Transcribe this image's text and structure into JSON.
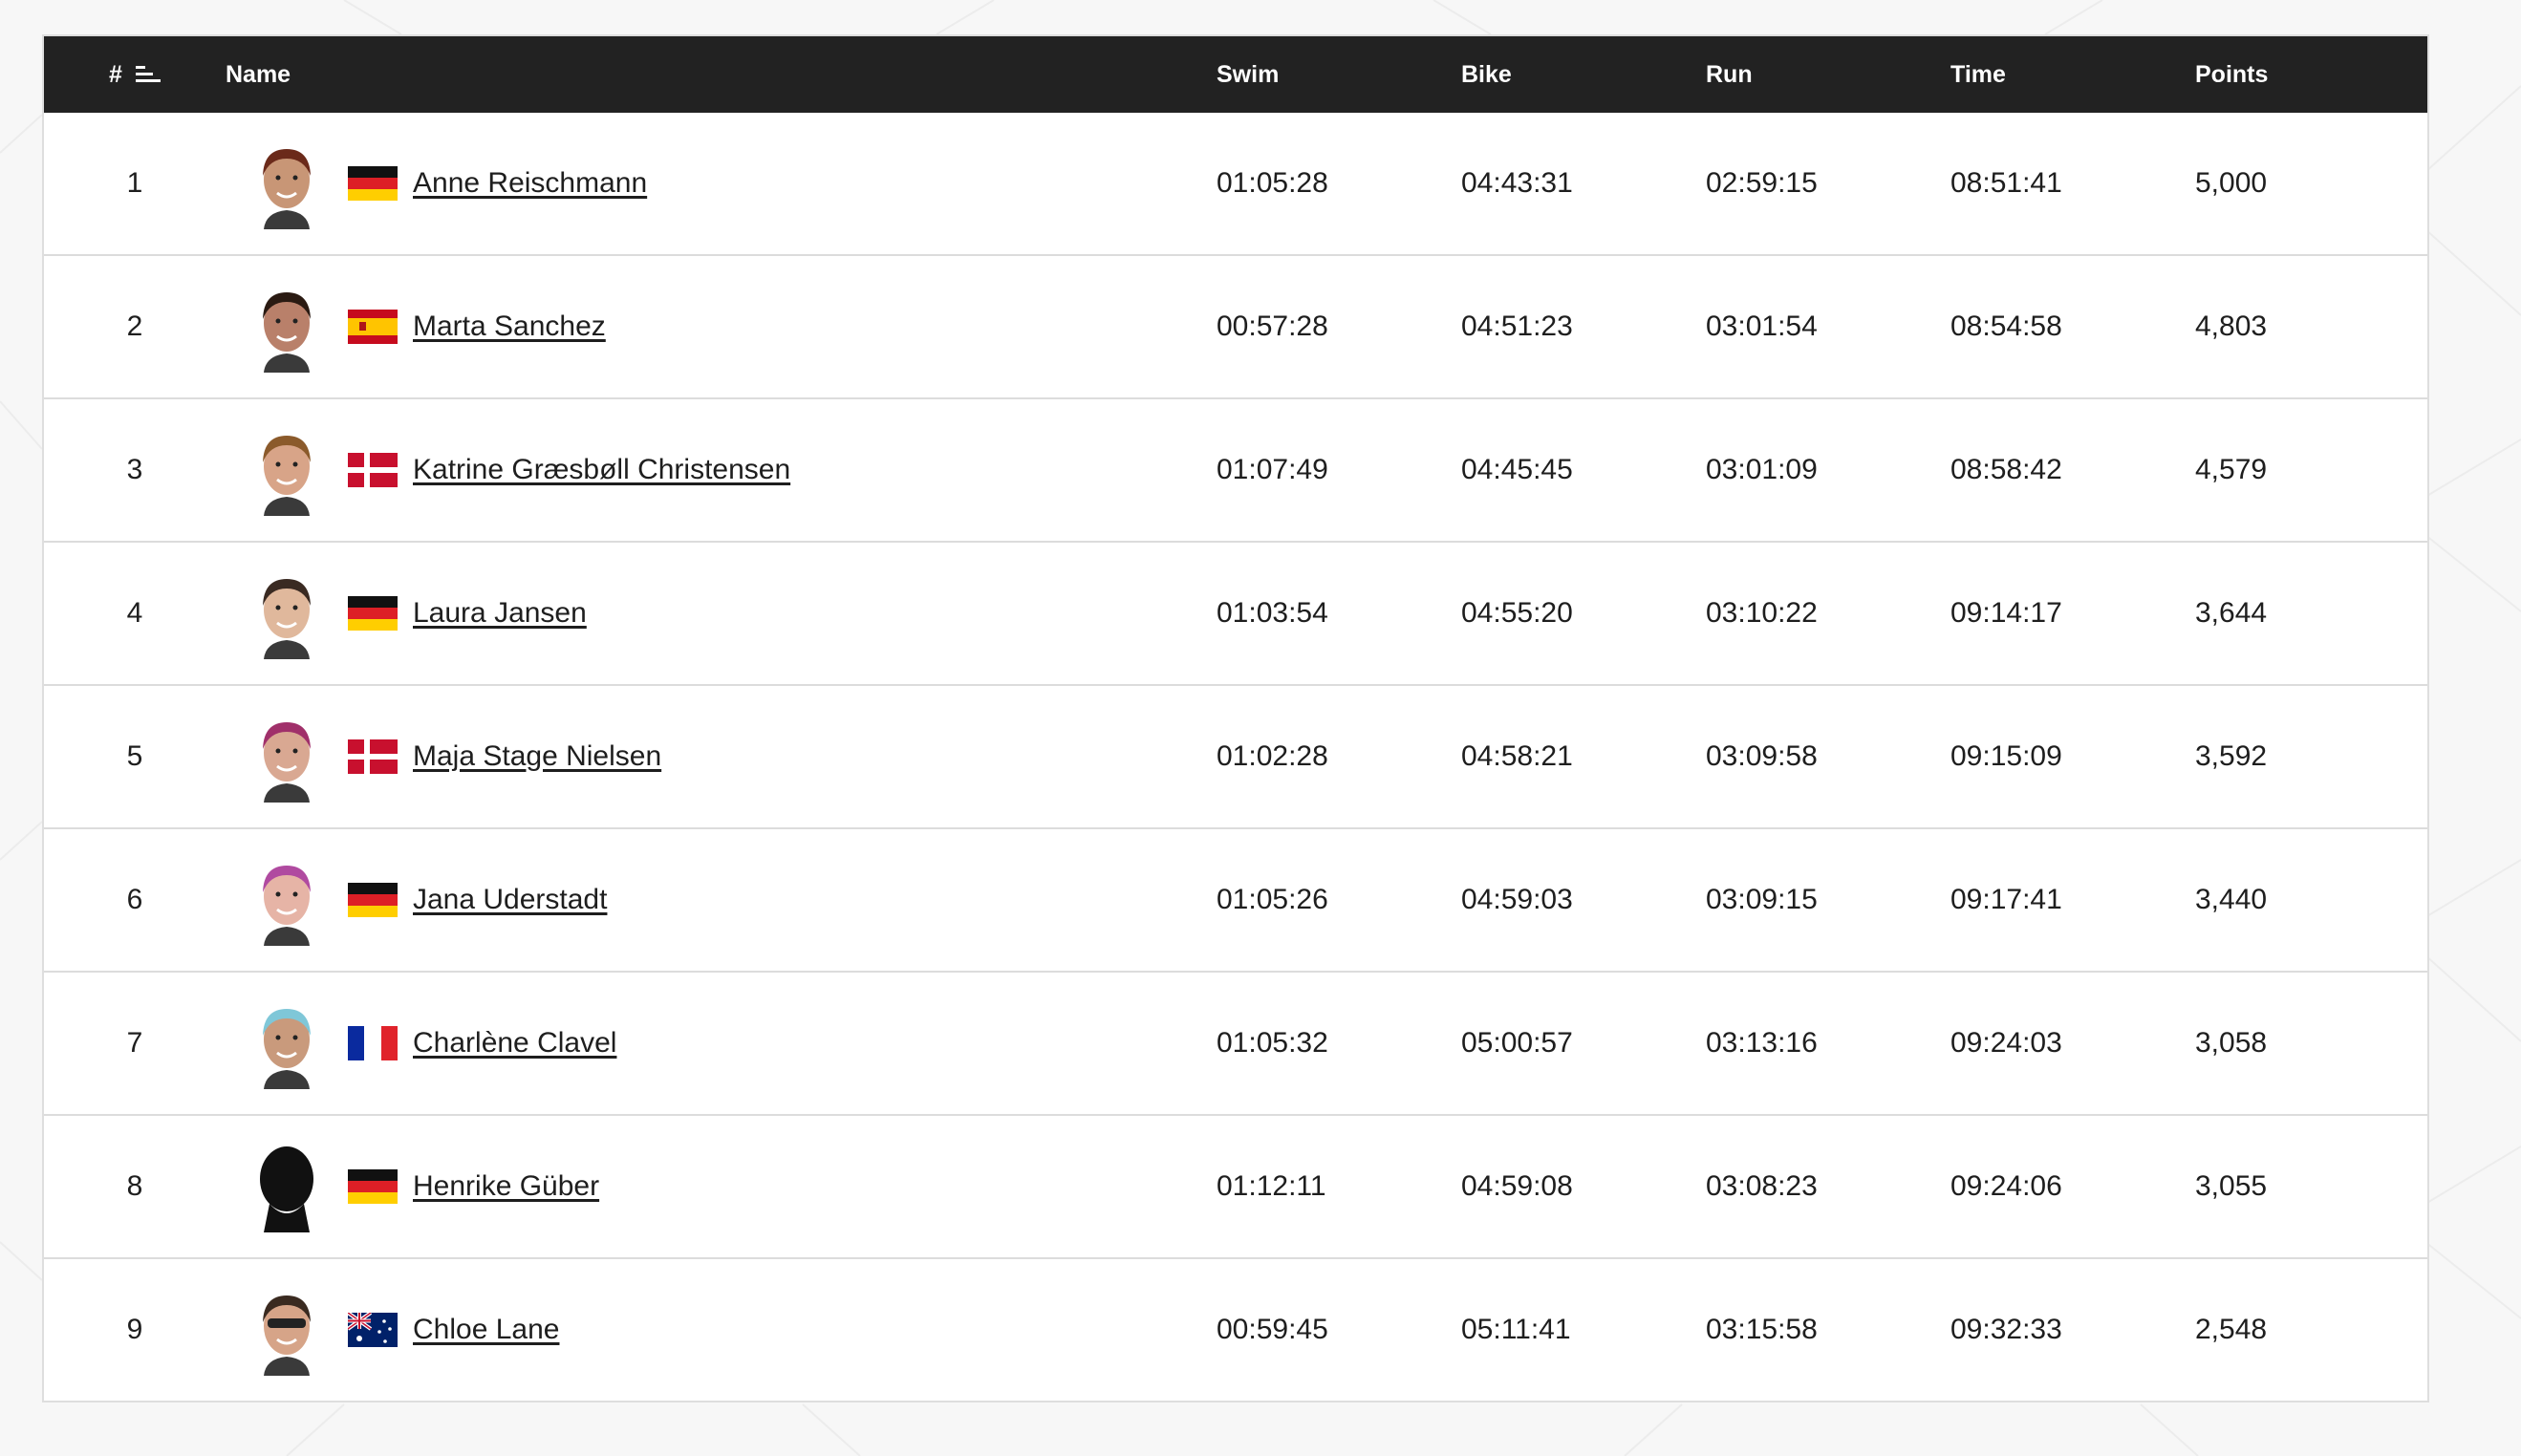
{
  "table": {
    "headers": {
      "rank": "#",
      "name": "Name",
      "swim": "Swim",
      "bike": "Bike",
      "run": "Run",
      "time": "Time",
      "points": "Points"
    },
    "rows": [
      {
        "rank": "1",
        "name": "Anne Reischmann",
        "flag": "germany-flag",
        "swim": "01:05:28",
        "bike": "04:43:31",
        "run": "02:59:15",
        "time": "08:51:41",
        "points": "5,000",
        "skin": "#c89676",
        "hair": "#6b2a1a"
      },
      {
        "rank": "2",
        "name": "Marta Sanchez",
        "flag": "spain-flag",
        "swim": "00:57:28",
        "bike": "04:51:23",
        "run": "03:01:54",
        "time": "08:54:58",
        "points": "4,803",
        "skin": "#b9806a",
        "hair": "#2a1a12"
      },
      {
        "rank": "3",
        "name": "Katrine Græsbøll Christensen",
        "flag": "denmark-flag",
        "swim": "01:07:49",
        "bike": "04:45:45",
        "run": "03:01:09",
        "time": "08:58:42",
        "points": "4,579",
        "skin": "#d8a488",
        "hair": "#8b5a2b"
      },
      {
        "rank": "4",
        "name": "Laura Jansen",
        "flag": "germany-flag",
        "swim": "01:03:54",
        "bike": "04:55:20",
        "run": "03:10:22",
        "time": "09:14:17",
        "points": "3,644",
        "skin": "#e0b89c",
        "hair": "#3a2a22"
      },
      {
        "rank": "5",
        "name": "Maja Stage Nielsen",
        "flag": "denmark-flag",
        "swim": "01:02:28",
        "bike": "04:58:21",
        "run": "03:09:58",
        "time": "09:15:09",
        "points": "3,592",
        "skin": "#d9a892",
        "hair": "#a0306a"
      },
      {
        "rank": "6",
        "name": "Jana Uderstadt",
        "flag": "germany-flag",
        "swim": "01:05:26",
        "bike": "04:59:03",
        "run": "03:09:15",
        "time": "09:17:41",
        "points": "3,440",
        "skin": "#e6b4a6",
        "hair": "#b04aa0"
      },
      {
        "rank": "7",
        "name": "Charlène Clavel",
        "flag": "france-flag",
        "swim": "01:05:32",
        "bike": "05:00:57",
        "run": "03:13:16",
        "time": "09:24:03",
        "points": "3,058",
        "skin": "#c99a7c",
        "hair": "#7fc7d8"
      },
      {
        "rank": "8",
        "name": "Henrike Güber",
        "flag": "germany-flag",
        "swim": "01:12:11",
        "bike": "04:59:08",
        "run": "03:08:23",
        "time": "09:24:06",
        "points": "3,055",
        "skin": "#111111",
        "hair": "#111111",
        "placeholder": true
      },
      {
        "rank": "9",
        "name": "Chloe Lane",
        "flag": "australia-flag",
        "swim": "00:59:45",
        "bike": "05:11:41",
        "run": "03:15:58",
        "time": "09:32:33",
        "points": "2,548",
        "skin": "#d6a488",
        "hair": "#3a2a20",
        "sunglasses": true
      }
    ]
  },
  "icons": {
    "sort": "sort-lines-icon",
    "avatar": "athlete-headshot"
  },
  "colors": {
    "header_bg": "#222222",
    "header_text": "#ffffff",
    "row_divider": "#dcdcdc",
    "page_bg": "#f7f7f7"
  }
}
